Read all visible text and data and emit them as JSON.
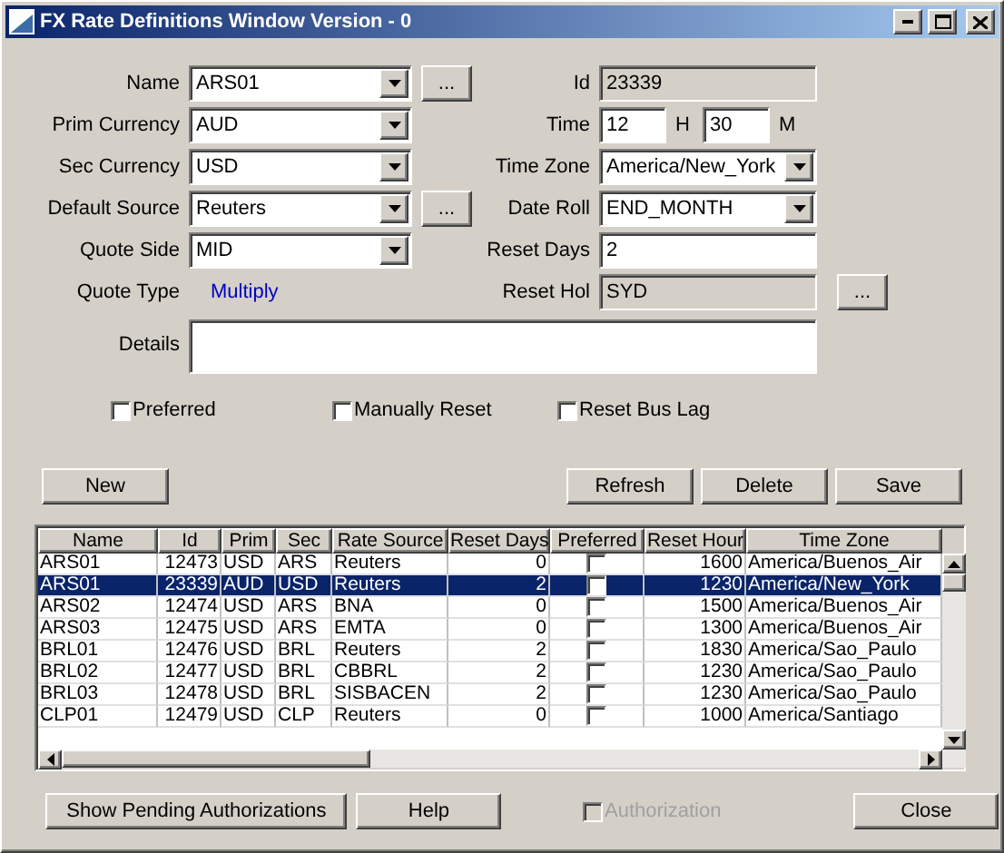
{
  "window": {
    "title": "FX Rate Definitions Window Version - 0"
  },
  "form": {
    "rows": [
      {
        "left": {
          "kind": "combo",
          "label": "Name",
          "value": "ARS01",
          "browse": "..."
        },
        "right": {
          "kind": "readonly",
          "label": "Id",
          "value": "23339"
        }
      },
      {
        "left": {
          "kind": "combo",
          "label": "Prim Currency",
          "value": "AUD"
        },
        "right": {
          "kind": "time",
          "label": "Time",
          "hours": "12",
          "hours_unit": "H",
          "minutes": "30",
          "minutes_unit": "M"
        }
      },
      {
        "left": {
          "kind": "combo",
          "label": "Sec Currency",
          "value": "USD"
        },
        "right": {
          "kind": "combo",
          "label": "Time Zone",
          "value": "America/New_York"
        }
      },
      {
        "left": {
          "kind": "combo",
          "label": "Default Source",
          "value": "Reuters",
          "browse": "..."
        },
        "right": {
          "kind": "combo",
          "label": "Date Roll",
          "value": "END_MONTH"
        }
      },
      {
        "left": {
          "kind": "combo",
          "label": "Quote Side",
          "value": "MID"
        },
        "right": {
          "kind": "text",
          "label": "Reset Days",
          "value": "2"
        }
      },
      {
        "left": {
          "kind": "static",
          "label": "Quote Type",
          "value": "Multiply"
        },
        "right": {
          "kind": "readonly",
          "label": "Reset Hol",
          "value": "SYD",
          "browse": "..."
        }
      }
    ],
    "details": {
      "label": "Details"
    },
    "options": [
      {
        "label": "Preferred",
        "checked": false
      },
      {
        "label": "Manually Reset",
        "checked": false
      },
      {
        "label": "Reset Bus Lag",
        "checked": false
      }
    ]
  },
  "actions": {
    "left": [
      "New"
    ],
    "right": [
      "Refresh",
      "Delete",
      "Save"
    ]
  },
  "table": {
    "columns": [
      "Name",
      "Id",
      "Prim",
      "Sec",
      "Rate Source",
      "Reset Days",
      "Preferred",
      "Reset Hour",
      "Time Zone"
    ],
    "rows": [
      {
        "name": "ARS01",
        "id": "12473",
        "prim": "USD",
        "sec": "ARS",
        "rate_source": "Reuters",
        "reset_days": "0",
        "preferred": false,
        "reset_hour": "1600",
        "time_zone": "America/Buenos_Air",
        "selected": false
      },
      {
        "name": "ARS01",
        "id": "23339",
        "prim": "AUD",
        "sec": "USD",
        "rate_source": "Reuters",
        "reset_days": "2",
        "preferred": false,
        "reset_hour": "1230",
        "time_zone": "America/New_York",
        "selected": true
      },
      {
        "name": "ARS02",
        "id": "12474",
        "prim": "USD",
        "sec": "ARS",
        "rate_source": "BNA",
        "reset_days": "0",
        "preferred": false,
        "reset_hour": "1500",
        "time_zone": "America/Buenos_Air",
        "selected": false
      },
      {
        "name": "ARS03",
        "id": "12475",
        "prim": "USD",
        "sec": "ARS",
        "rate_source": "EMTA",
        "reset_days": "0",
        "preferred": false,
        "reset_hour": "1300",
        "time_zone": "America/Buenos_Air",
        "selected": false
      },
      {
        "name": "BRL01",
        "id": "12476",
        "prim": "USD",
        "sec": "BRL",
        "rate_source": "Reuters",
        "reset_days": "2",
        "preferred": false,
        "reset_hour": "1830",
        "time_zone": "America/Sao_Paulo",
        "selected": false
      },
      {
        "name": "BRL02",
        "id": "12477",
        "prim": "USD",
        "sec": "BRL",
        "rate_source": "CBBRL",
        "reset_days": "2",
        "preferred": false,
        "reset_hour": "1230",
        "time_zone": "America/Sao_Paulo",
        "selected": false
      },
      {
        "name": "BRL03",
        "id": "12478",
        "prim": "USD",
        "sec": "BRL",
        "rate_source": "SISBACEN",
        "reset_days": "2",
        "preferred": false,
        "reset_hour": "1230",
        "time_zone": "America/Sao_Paulo",
        "selected": false
      },
      {
        "name": "CLP01",
        "id": "12479",
        "prim": "USD",
        "sec": "CLP",
        "rate_source": "Reuters",
        "reset_days": "0",
        "preferred": false,
        "reset_hour": "1000",
        "time_zone": "America/Santiago",
        "selected": false
      }
    ]
  },
  "footer": {
    "buttons": [
      "Show Pending Authorizations",
      "Help"
    ],
    "authorization": {
      "label": "Authorization",
      "checked": false,
      "disabled": true
    },
    "close": "Close"
  }
}
